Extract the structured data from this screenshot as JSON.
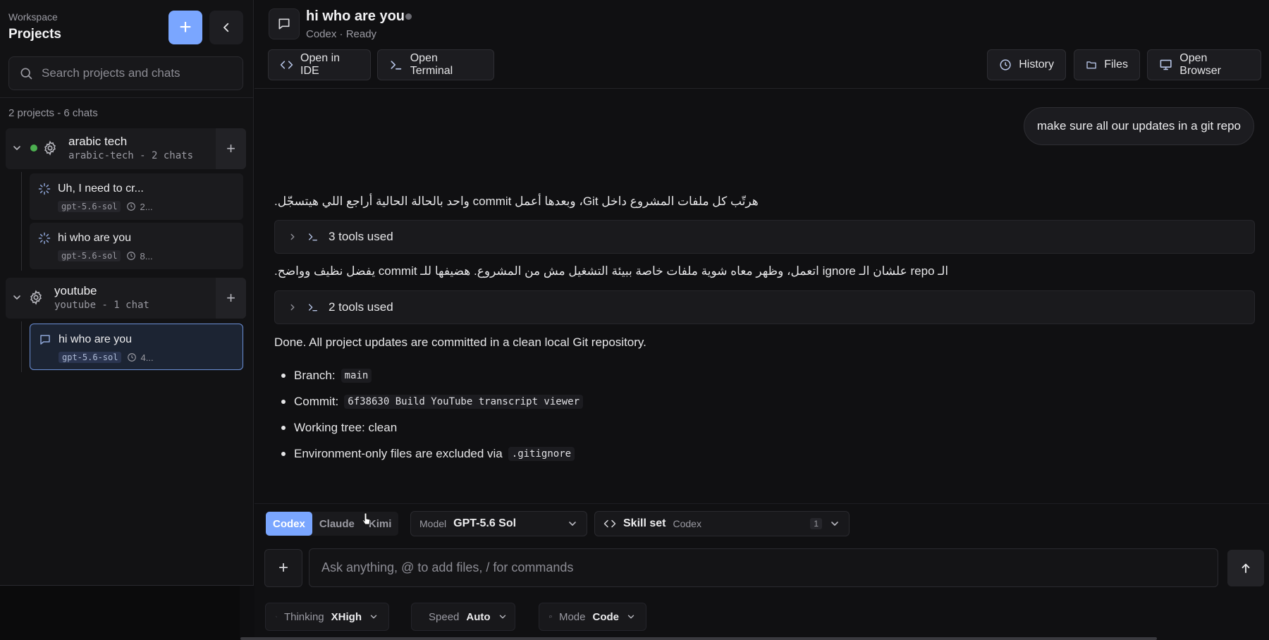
{
  "sidebar": {
    "workspace_label": "Workspace",
    "title": "Projects",
    "search_placeholder": "Search projects and chats",
    "counts": "2 projects - 6 chats",
    "projects": [
      {
        "name": "arabic tech",
        "sub": "arabic-tech - 2 chats",
        "status_color": "#4caf50",
        "chats": [
          {
            "title": "Uh, I need to cr...",
            "model": "gpt-5.6-sol",
            "time": "2..."
          },
          {
            "title": "hi who are you",
            "model": "gpt-5.6-sol",
            "time": "8..."
          }
        ]
      },
      {
        "name": "youtube",
        "sub": "youtube - 1 chat",
        "chats": [
          {
            "title": "hi who are you",
            "model": "gpt-5.6-sol",
            "time": "4..."
          }
        ]
      }
    ]
  },
  "header": {
    "title": "hi who are you",
    "status": "Codex · Ready",
    "toolbar": {
      "open_ide": "Open in IDE",
      "open_terminal": "Open Terminal",
      "history": "History",
      "files": "Files",
      "open_browser": "Open Browser"
    }
  },
  "conversation": {
    "user_message": "make sure all our updates in a git repo",
    "assistant_ar_1": "هرتّب كل ملفات المشروع داخل Git، وبعدها أعمل commit واحد بالحالة الحالية أراجع اللي هيتسجّل.",
    "tools_1": "3 tools used",
    "assistant_ar_2": "الـ repo علشان الـ ignore اتعمل، وظهر معاه شوية ملفات خاصة ببيئة التشغيل مش من المشروع. هضيفها للـ commit يفضل نظيف وواضح.",
    "tools_2": "2 tools used",
    "done_text": "Done. All project updates are committed in a clean local Git repository.",
    "bullets": [
      {
        "label": "Branch:",
        "code": "main"
      },
      {
        "label": "Commit:",
        "code": "6f38630 Build YouTube transcript viewer"
      },
      {
        "label": "Working tree: clean",
        "code": ""
      },
      {
        "label": "Environment-only files are excluded via",
        "code": ".gitignore"
      }
    ]
  },
  "composer": {
    "agents": [
      "Codex",
      "Claude",
      "Kimi"
    ],
    "active_agent": "Codex",
    "model_label": "Model",
    "model_value": "GPT-5.6 Sol",
    "skill_label": "Skill set",
    "skill_value": "Codex",
    "skill_count": "1",
    "placeholder": "Ask anything, @ to add files, / for commands",
    "thinking_label": "Thinking",
    "thinking_value": "XHigh",
    "speed_label": "Speed",
    "speed_value": "Auto",
    "mode_label": "Mode",
    "mode_value": "Code"
  },
  "colors": {
    "accent": "#7aa6ff",
    "active_border": "#6b8fd6",
    "status_green": "#4caf50"
  }
}
